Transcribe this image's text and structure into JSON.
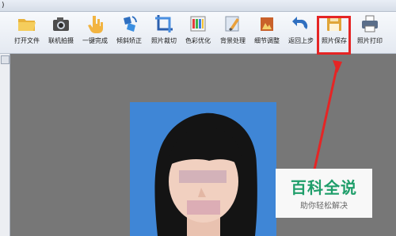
{
  "menu": {
    "fragment": ")"
  },
  "toolbar": {
    "items": [
      {
        "label": "打开文件",
        "icon": "folder-open-icon"
      },
      {
        "label": "联机拍摄",
        "icon": "camera-icon"
      },
      {
        "label": "一键完成",
        "icon": "hand-pointer-icon"
      },
      {
        "label": "倾斜矫正",
        "icon": "rotate-correct-icon"
      },
      {
        "label": "照片裁切",
        "icon": "crop-icon"
      },
      {
        "label": "色彩优化",
        "icon": "color-bars-icon"
      },
      {
        "label": "背景处理",
        "icon": "brush-background-icon"
      },
      {
        "label": "细节调整",
        "icon": "detail-adjust-icon"
      },
      {
        "label": "返回上步",
        "icon": "undo-arrow-icon"
      },
      {
        "label": "照片保存",
        "icon": "floppy-save-icon"
      },
      {
        "label": "照片打印",
        "icon": "printer-icon"
      }
    ]
  },
  "colors": {
    "photo_background": "#3f86d6",
    "highlight": "#e52525",
    "watermark_title": "#1f9e6a"
  },
  "watermark": {
    "title": "百科全说",
    "subtitle": "助你轻松解决"
  }
}
